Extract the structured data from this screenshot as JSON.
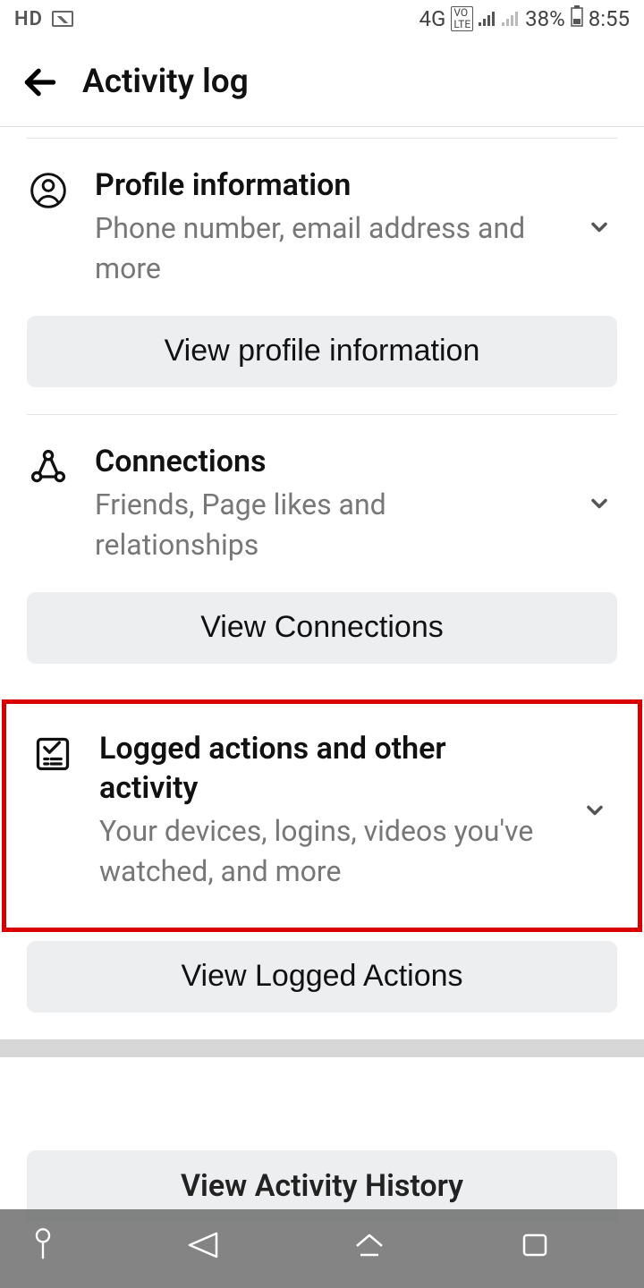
{
  "status_bar": {
    "hd": "HD",
    "network": "4G",
    "battery": "38%",
    "time": "8:55"
  },
  "header": {
    "title": "Activity log"
  },
  "sections": {
    "profile": {
      "title": "Profile information",
      "subtitle": "Phone number, email address and more",
      "button": "View profile information"
    },
    "connections": {
      "title": "Connections",
      "subtitle": "Friends, Page likes and relationships",
      "button": "View Connections"
    },
    "logged": {
      "title": "Logged actions and other activity",
      "subtitle": "Your devices, logins, videos you've watched, and more",
      "button": "View Logged Actions"
    },
    "history": {
      "button": "View Activity History"
    }
  }
}
